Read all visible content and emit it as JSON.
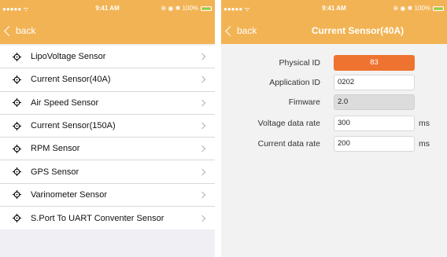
{
  "left": {
    "status": {
      "signal": "●●●●● ᯤ",
      "time": "9:41 AM",
      "right": "⊕ ◉ ✱ 100%"
    },
    "nav": {
      "back_label": "back"
    },
    "items": [
      {
        "label": "LipoVoltage Sensor"
      },
      {
        "label": "Current Sensor(40A)"
      },
      {
        "label": "Air Speed Sensor"
      },
      {
        "label": "Current Sensor(150A)"
      },
      {
        "label": "RPM Sensor"
      },
      {
        "label": "GPS Sensor"
      },
      {
        "label": "Varinometer Sensor"
      },
      {
        "label": "S.Port To UART Conventer Sensor"
      }
    ]
  },
  "right": {
    "status": {
      "signal": "●●●●● ᯤ",
      "time": "9:41 AM",
      "right": "⊕ ◉ ✱ 100%"
    },
    "nav": {
      "back_label": "back",
      "title": "Current Sensor(40A)"
    },
    "form": {
      "physical_id": {
        "label": "Physical ID",
        "value": "83"
      },
      "application_id": {
        "label": "Application ID",
        "value": "0202"
      },
      "firmware": {
        "label": "Fimware",
        "value": "2.0"
      },
      "voltage_rate": {
        "label": "Voltage data rate",
        "value": "300",
        "unit": "ms"
      },
      "current_rate": {
        "label": "Current data rate",
        "value": "200",
        "unit": "ms"
      }
    }
  },
  "colors": {
    "accent": "#f2b354",
    "highlight": "#ef7330",
    "battery": "#6fe04a"
  },
  "icons": {
    "list_item": "crosshair-icon",
    "back": "chevron-left-icon",
    "row_disclosure": "chevron-right-icon"
  }
}
